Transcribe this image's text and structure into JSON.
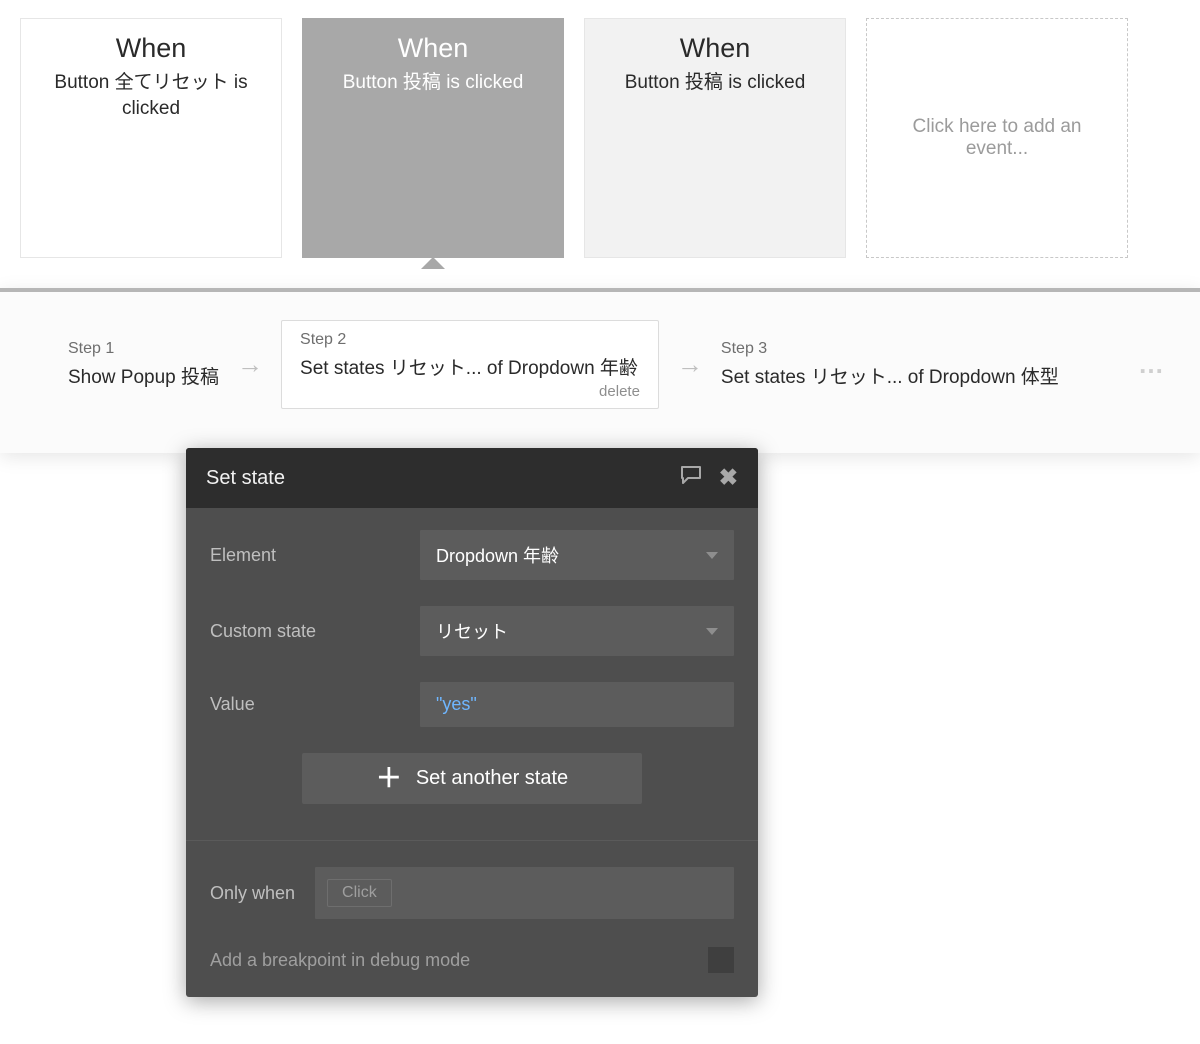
{
  "events": [
    {
      "title": "When",
      "desc": "Button 全てリセット is clicked",
      "variant": "plain"
    },
    {
      "title": "When",
      "desc": "Button 投稿 is clicked",
      "variant": "selected"
    },
    {
      "title": "When",
      "desc": "Button 投稿 is clicked",
      "variant": "dim"
    }
  ],
  "add_event_placeholder": "Click here to add an event...",
  "steps": [
    {
      "label": "Step 1",
      "text": "Show Popup 投稿"
    },
    {
      "label": "Step 2",
      "text": "Set states リセット... of Dropdown 年齢",
      "boxed": true,
      "delete": "delete"
    },
    {
      "label": "Step 3",
      "text": "Set states リセット... of Dropdown 体型"
    }
  ],
  "arrow_glyph": "→",
  "ellipsis_glyph": "…",
  "panel": {
    "title": "Set state",
    "fields": {
      "element_label": "Element",
      "element_value": "Dropdown 年齢",
      "custom_state_label": "Custom state",
      "custom_state_value": "リセット",
      "value_label": "Value",
      "value_expr": "\"yes\""
    },
    "add_state_label": "Set another state",
    "only_label": "Only when",
    "only_placeholder": "Click",
    "breakpoint_label": "Add a breakpoint in debug mode"
  }
}
